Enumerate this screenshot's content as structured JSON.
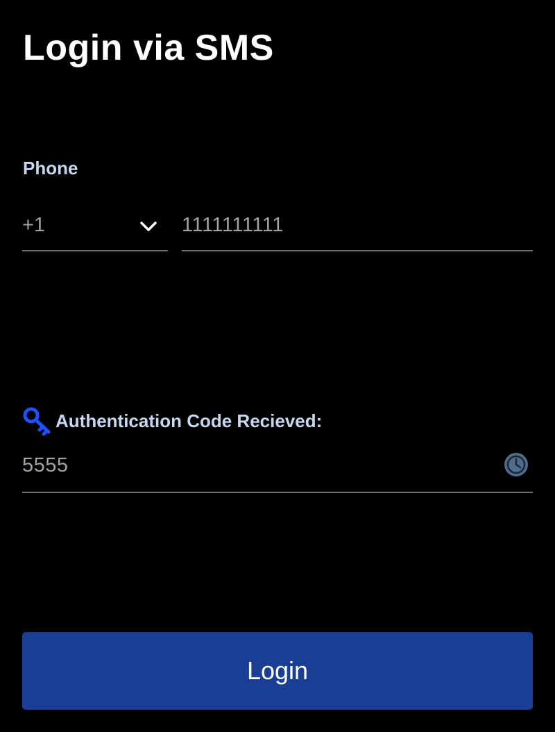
{
  "page": {
    "title": "Login via SMS"
  },
  "phone": {
    "label": "Phone",
    "country_code": "+1",
    "number_value": "1111111111",
    "number_placeholder": ""
  },
  "auth_code": {
    "label": "Authentication Code Recieved:",
    "value": "5555"
  },
  "login": {
    "label": "Login"
  },
  "icons": {
    "country_dropdown": "chevron-down-icon",
    "auth_label": "key-icon",
    "code_field": "clock-icon"
  },
  "colors": {
    "background": "#000000",
    "label": "#c6d7ef",
    "input_text": "#9fa2a8",
    "underline": "#6e7178",
    "key_icon": "#1f4fff",
    "clock_icon": "#4e6c8c",
    "button": "#1b3e95",
    "button_text": "#ffffff"
  }
}
